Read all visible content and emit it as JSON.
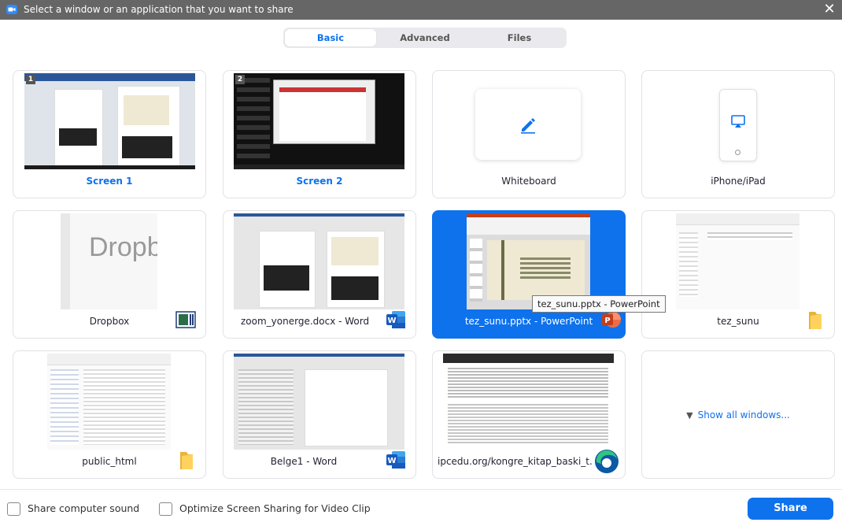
{
  "window": {
    "title": "Select a window or an application that you want to share",
    "close_glyph": "✕"
  },
  "tabs": [
    {
      "label": "Basic",
      "active": true
    },
    {
      "label": "Advanced",
      "active": false
    },
    {
      "label": "Files",
      "active": false
    }
  ],
  "cards": {
    "screen1": {
      "label": "Screen 1",
      "badge": "1"
    },
    "screen2": {
      "label": "Screen 2",
      "badge": "2"
    },
    "whiteboard": {
      "label": "Whiteboard",
      "icon": "pencil-icon"
    },
    "iphone": {
      "label": "iPhone/iPad",
      "icon": "airplay-icon"
    },
    "dropbox": {
      "label": "Dropbox",
      "thumb_text": "Dropb",
      "icon": "dropbox-app-icon"
    },
    "zoom_doc": {
      "label": "zoom_yonerge.docx - Word",
      "icon": "word-icon"
    },
    "tez_pptx": {
      "label": "tez_sunu.pptx - PowerPoint",
      "icon": "powerpoint-icon",
      "selected": true
    },
    "tez_folder": {
      "label": "tez_sunu",
      "icon": "folder-icon"
    },
    "public_html": {
      "label": "public_html",
      "icon": "folder-icon"
    },
    "belge1": {
      "label": "Belge1 - Word",
      "icon": "word-icon"
    },
    "ipcedu": {
      "label": "ipcedu.org/kongre_kitap_baski_t...",
      "icon": "edge-icon"
    },
    "showall": {
      "label": "Show all windows...",
      "icon": "chevron-down-icon"
    }
  },
  "tooltip": {
    "text": "tez_sunu.pptx - PowerPoint"
  },
  "footer": {
    "share_sound_label": "Share computer sound",
    "share_sound_checked": false,
    "optimize_label": "Optimize Screen Sharing for Video Clip",
    "optimize_checked": false,
    "share_button": "Share"
  },
  "colors": {
    "accent": "#0e72ed",
    "titlebar": "#666666"
  }
}
